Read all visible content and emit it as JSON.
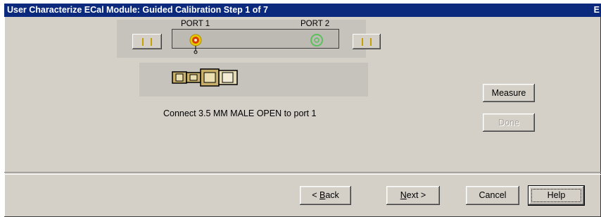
{
  "window": {
    "title": "User Characterize ECal Module: Guided Calibration Step 1 of 7",
    "title_right": "E"
  },
  "diagram": {
    "port1_label": "PORT 1",
    "port2_label": "PORT 2",
    "colors": {
      "port1_ring": "#e8c800",
      "port1_inner": "#d83c00",
      "port2_ring": "#5cc15c",
      "connector_gold": "#c9b06a"
    }
  },
  "instruction": "Connect 3.5 MM MALE OPEN to port 1",
  "buttons": {
    "measure": "Measure",
    "done": "Done",
    "back_prefix": "< ",
    "back_mnemonic": "B",
    "back_rest": "ack",
    "next_mnemonic": "N",
    "next_rest": "ext >",
    "cancel": "Cancel",
    "help": "Help"
  }
}
